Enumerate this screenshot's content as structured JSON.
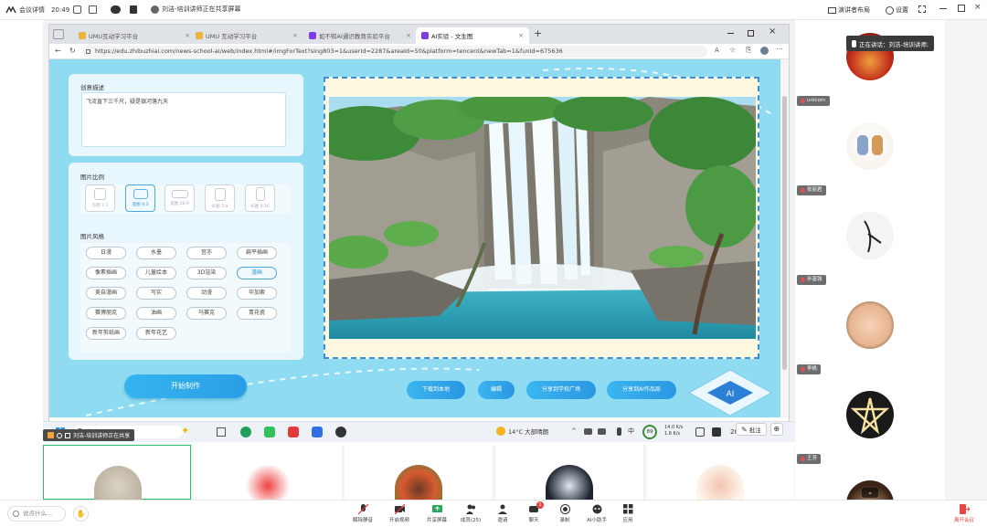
{
  "meeting": {
    "details_label": "会议详情",
    "time": "20:49",
    "presenter_bar": "刘洁-培训讲师正在共享屏幕",
    "layout_label": "演讲者布局",
    "settings_label": "设置",
    "sharing_badge": "刘洁-培训讲师正在共享",
    "speaking_label": "正在讲话：刘洁-培训讲师;"
  },
  "browser": {
    "tabs": [
      {
        "label": "UMU互动学习平台"
      },
      {
        "label": "UMU 互动学习平台"
      },
      {
        "label": "如不知AI通识教育实验平台"
      },
      {
        "label": "AI实验 - 文生图"
      }
    ],
    "url": "https://edu.zhibuzhiai.com/news-school-ai/web/index.html#/imgForText?sing803=1&userId=2287&areaId=50&platform=tencent&newTab=1&funId=675636"
  },
  "app": {
    "desc_title": "创意描述",
    "desc_text": "飞流直下三千尺，疑是银河落九天",
    "ratio_title": "图片比例",
    "ratios": [
      {
        "label": "方图 1:1"
      },
      {
        "label": "宽图 4:3"
      },
      {
        "label": "宽图 16:9"
      },
      {
        "label": "长图 3:4"
      },
      {
        "label": "长图 9:16"
      }
    ],
    "style_title": "图片风格",
    "styles": [
      [
        "日漫",
        "水墨",
        "宫亦",
        "扁平插画"
      ],
      [
        "像素插画",
        "儿童绘本",
        "3D渲染",
        "漫画"
      ],
      [
        "美自漫画",
        "写实",
        "动漫",
        "毕加索"
      ],
      [
        "赛博朋克",
        "油画",
        "马赛克",
        "青花瓷"
      ],
      [
        "新年剪纸画",
        "新年花艺"
      ]
    ],
    "selected_style": "漫画",
    "start_label": "开始制作",
    "actions": [
      "下载到本地",
      "编辑",
      "分享到学校广场",
      "分享到AI作品局"
    ]
  },
  "taskbar": {
    "search_placeholder": "搜索",
    "weather": "14°C 大部晴朗",
    "lang": "中",
    "net_up": "14.0 K/s",
    "net_down": "1.6 K/s",
    "battery_text": "89",
    "year_partial": "20",
    "annotate_label": "批注"
  },
  "participants": {
    "right": [
      {
        "name": "unicorn"
      },
      {
        "name": "张丽君"
      },
      {
        "name": "孙富强"
      },
      {
        "name": "李帆"
      },
      {
        "name": "王芳"
      }
    ]
  },
  "toolbar": {
    "chat_placeholder": "说点什么...",
    "items": [
      {
        "label": "解除静音"
      },
      {
        "label": "开启视频"
      },
      {
        "label": "共享屏幕"
      },
      {
        "label": "成员(25)"
      },
      {
        "label": "邀请"
      },
      {
        "label": "聊天"
      },
      {
        "label": "录制"
      },
      {
        "label": "AI小助手"
      },
      {
        "label": "应用"
      }
    ],
    "chat_badge": "1",
    "leave_label": "离开会议"
  },
  "colors": {
    "page_bg": "#8fdcf2",
    "primary_btn": "#2a9ee6",
    "leave": "#e64545"
  }
}
